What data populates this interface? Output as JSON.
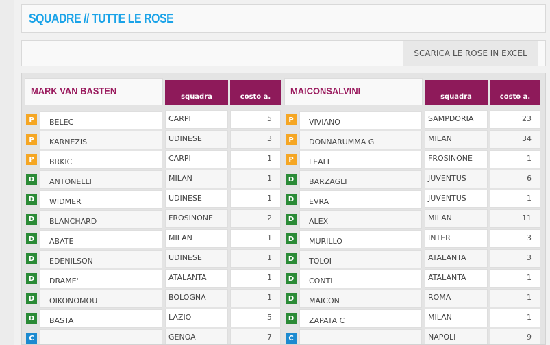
{
  "header": {
    "title": "SQUADRE // TUTTE LE ROSE"
  },
  "toolbar": {
    "download_label": "SCARICA LE ROSE IN EXCEL"
  },
  "columns": {
    "club": "squadra",
    "cost": "costo a."
  },
  "teams": [
    {
      "name": "MARK VAN BASTEN",
      "players": [
        {
          "role": "P",
          "name": "BELEC",
          "club": "CARPI",
          "cost": "5"
        },
        {
          "role": "P",
          "name": "KARNEZIS",
          "club": "UDINESE",
          "cost": "3"
        },
        {
          "role": "P",
          "name": "BRKIC",
          "club": "CARPI",
          "cost": "1"
        },
        {
          "role": "D",
          "name": "ANTONELLI",
          "club": "MILAN",
          "cost": "1"
        },
        {
          "role": "D",
          "name": "WIDMER",
          "club": "UDINESE",
          "cost": "1"
        },
        {
          "role": "D",
          "name": "BLANCHARD",
          "club": "FROSINONE",
          "cost": "2"
        },
        {
          "role": "D",
          "name": "ABATE",
          "club": "MILAN",
          "cost": "1"
        },
        {
          "role": "D",
          "name": "EDENILSON",
          "club": "UDINESE",
          "cost": "1"
        },
        {
          "role": "D",
          "name": "DRAME'",
          "club": "ATALANTA",
          "cost": "1"
        },
        {
          "role": "D",
          "name": "OIKONOMOU",
          "club": "BOLOGNA",
          "cost": "1"
        },
        {
          "role": "D",
          "name": "BASTA",
          "club": "LAZIO",
          "cost": "5"
        },
        {
          "role": "C",
          "name": "",
          "club": "GENOA",
          "cost": "7"
        }
      ]
    },
    {
      "name": "MAICONSALVINI",
      "players": [
        {
          "role": "P",
          "name": "VIVIANO",
          "club": "SAMPDORIA",
          "cost": "23"
        },
        {
          "role": "P",
          "name": "DONNARUMMA G",
          "club": "MILAN",
          "cost": "34"
        },
        {
          "role": "P",
          "name": "LEALI",
          "club": "FROSINONE",
          "cost": "1"
        },
        {
          "role": "D",
          "name": "BARZAGLI",
          "club": "JUVENTUS",
          "cost": "6"
        },
        {
          "role": "D",
          "name": "EVRA",
          "club": "JUVENTUS",
          "cost": "1"
        },
        {
          "role": "D",
          "name": "ALEX",
          "club": "MILAN",
          "cost": "11"
        },
        {
          "role": "D",
          "name": "MURILLO",
          "club": "INTER",
          "cost": "3"
        },
        {
          "role": "D",
          "name": "TOLOI",
          "club": "ATALANTA",
          "cost": "3"
        },
        {
          "role": "D",
          "name": "CONTI",
          "club": "ATALANTA",
          "cost": "1"
        },
        {
          "role": "D",
          "name": "MAICON",
          "club": "ROMA",
          "cost": "1"
        },
        {
          "role": "D",
          "name": "ZAPATA C",
          "club": "MILAN",
          "cost": "1"
        },
        {
          "role": "C",
          "name": "",
          "club": "NAPOLI",
          "cost": "9"
        }
      ]
    }
  ],
  "colors": {
    "title": "#1aa3e8",
    "team_name": "#9a1b5e",
    "column_header": "#8e1a5a",
    "role_P": "#f5a623",
    "role_D": "#2a8a36",
    "role_C": "#1b8ad0"
  }
}
